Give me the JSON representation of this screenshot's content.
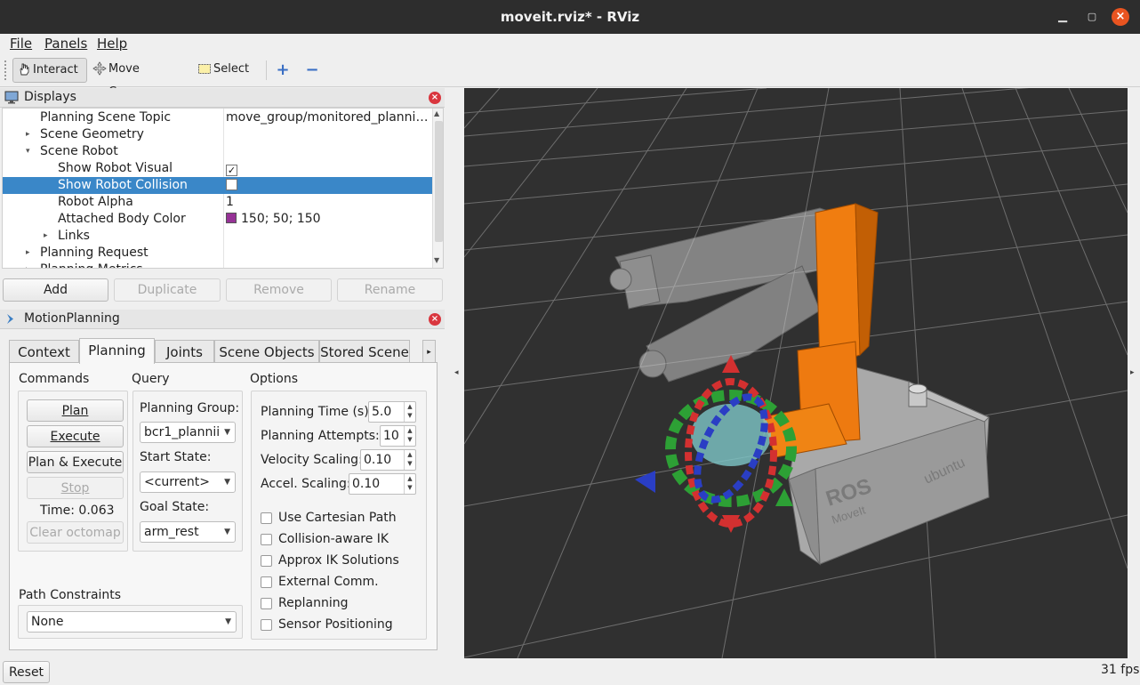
{
  "window": {
    "title": "moveit.rviz* - RViz"
  },
  "menu": {
    "file": "File",
    "panels": "Panels",
    "help": "Help"
  },
  "toolbar": {
    "interact": "Interact",
    "move_camera": "Move Camera",
    "select": "Select"
  },
  "displays": {
    "title": "Displays",
    "rows": [
      {
        "key": "Planning Scene Topic",
        "value": "move_group/monitored_planni…"
      },
      {
        "key": "Scene Geometry",
        "value": ""
      },
      {
        "key": "Scene Robot",
        "value": ""
      },
      {
        "key": "Show Robot Visual",
        "value": "✓"
      },
      {
        "key": "Show Robot Collision",
        "value": ""
      },
      {
        "key": "Robot Alpha",
        "value": "1"
      },
      {
        "key": "Attached Body Color",
        "value": "150; 50; 150"
      },
      {
        "key": "Links",
        "value": ""
      },
      {
        "key": "Planning Request",
        "value": ""
      },
      {
        "key": "Planning Metrics",
        "value": ""
      }
    ],
    "attached_color": "#963296",
    "buttons": {
      "add": "Add",
      "duplicate": "Duplicate",
      "remove": "Remove",
      "rename": "Rename"
    }
  },
  "motion_planning": {
    "title": "MotionPlanning",
    "tabs": [
      "Context",
      "Planning",
      "Joints",
      "Scene Objects",
      "Stored Scene"
    ],
    "active_tab": "Planning",
    "commands": {
      "heading": "Commands",
      "plan": "Plan",
      "execute": "Execute",
      "plan_execute": "Plan & Execute",
      "stop": "Stop",
      "time": "Time: 0.063",
      "clear_octomap": "Clear octomap"
    },
    "query": {
      "heading": "Query",
      "planning_group_label": "Planning Group:",
      "planning_group": "bcr1_plannii",
      "start_state_label": "Start State:",
      "start_state": "<current>",
      "goal_state_label": "Goal State:",
      "goal_state": "arm_rest"
    },
    "options": {
      "heading": "Options",
      "planning_time_label": "Planning Time (s):",
      "planning_time": "5.0",
      "planning_attempts_label": "Planning Attempts:",
      "planning_attempts": "10",
      "velocity_scaling_label": "Velocity Scaling:",
      "velocity_scaling": "0.10",
      "accel_scaling_label": "Accel. Scaling:",
      "accel_scaling": "0.10",
      "checkboxes": [
        "Use Cartesian Path",
        "Collision-aware IK",
        "Approx IK Solutions",
        "External Comm.",
        "Replanning",
        "Sensor Positioning"
      ]
    },
    "path_constraints": {
      "label": "Path Constraints",
      "value": "None"
    }
  },
  "viewport": {
    "base_text_1": "ROS",
    "base_text_2": "MoveIt",
    "base_text_3": "ubuntu"
  },
  "status": {
    "reset": "Reset",
    "fps": "31 fps"
  }
}
